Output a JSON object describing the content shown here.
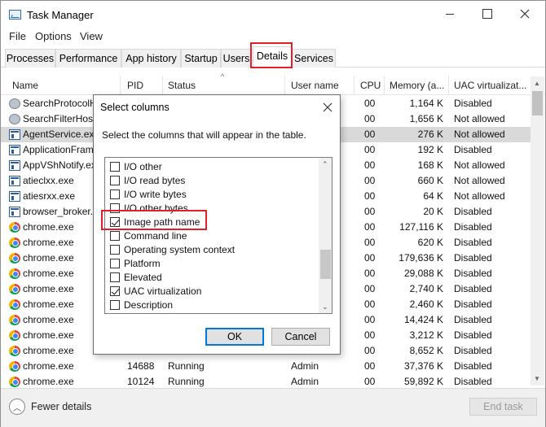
{
  "window": {
    "title": "Task Manager"
  },
  "menu": [
    "File",
    "Options",
    "View"
  ],
  "tabs": [
    "Processes",
    "Performance",
    "App history",
    "Startup",
    "Users",
    "Details",
    "Services"
  ],
  "active_tab": "Details",
  "columns": [
    "Name",
    "PID",
    "Status",
    "User name",
    "CPU",
    "Memory (a...",
    "UAC virtualizat..."
  ],
  "rows": [
    {
      "name": "SearchProtocolH",
      "pid": "",
      "status": "",
      "user": "",
      "cpu": "00",
      "mem": "1,164 K",
      "uac": "Disabled",
      "icon": "search"
    },
    {
      "name": "SearchFilterHost.",
      "pid": "",
      "status": "",
      "user": "",
      "cpu": "00",
      "mem": "1,656 K",
      "uac": "Not allowed",
      "icon": "search"
    },
    {
      "name": "AgentService.exe",
      "pid": "",
      "status": "",
      "user": "",
      "cpu": "00",
      "mem": "276 K",
      "uac": "Not allowed",
      "icon": "proc"
    },
    {
      "name": "ApplicationFram",
      "pid": "",
      "status": "",
      "user": "",
      "cpu": "00",
      "mem": "192 K",
      "uac": "Disabled",
      "icon": "proc"
    },
    {
      "name": "AppVShNotify.ex",
      "pid": "",
      "status": "",
      "user": "",
      "cpu": "00",
      "mem": "168 K",
      "uac": "Not allowed",
      "icon": "proc"
    },
    {
      "name": "atieclxx.exe",
      "pid": "",
      "status": "",
      "user": "",
      "cpu": "00",
      "mem": "660 K",
      "uac": "Not allowed",
      "icon": "proc"
    },
    {
      "name": "atiesrxx.exe",
      "pid": "",
      "status": "",
      "user": "",
      "cpu": "00",
      "mem": "64 K",
      "uac": "Not allowed",
      "icon": "proc"
    },
    {
      "name": "browser_broker.e",
      "pid": "",
      "status": "",
      "user": "",
      "cpu": "00",
      "mem": "20 K",
      "uac": "Disabled",
      "icon": "proc"
    },
    {
      "name": "chrome.exe",
      "pid": "",
      "status": "",
      "user": "",
      "cpu": "00",
      "mem": "127,116 K",
      "uac": "Disabled",
      "icon": "chrome"
    },
    {
      "name": "chrome.exe",
      "pid": "",
      "status": "",
      "user": "",
      "cpu": "00",
      "mem": "620 K",
      "uac": "Disabled",
      "icon": "chrome"
    },
    {
      "name": "chrome.exe",
      "pid": "",
      "status": "",
      "user": "",
      "cpu": "00",
      "mem": "179,636 K",
      "uac": "Disabled",
      "icon": "chrome"
    },
    {
      "name": "chrome.exe",
      "pid": "",
      "status": "",
      "user": "",
      "cpu": "00",
      "mem": "29,088 K",
      "uac": "Disabled",
      "icon": "chrome"
    },
    {
      "name": "chrome.exe",
      "pid": "",
      "status": "",
      "user": "",
      "cpu": "00",
      "mem": "2,740 K",
      "uac": "Disabled",
      "icon": "chrome"
    },
    {
      "name": "chrome.exe",
      "pid": "",
      "status": "",
      "user": "",
      "cpu": "00",
      "mem": "2,460 K",
      "uac": "Disabled",
      "icon": "chrome"
    },
    {
      "name": "chrome.exe",
      "pid": "",
      "status": "",
      "user": "",
      "cpu": "00",
      "mem": "14,424 K",
      "uac": "Disabled",
      "icon": "chrome"
    },
    {
      "name": "chrome.exe",
      "pid": "",
      "status": "",
      "user": "",
      "cpu": "00",
      "mem": "3,212 K",
      "uac": "Disabled",
      "icon": "chrome"
    },
    {
      "name": "chrome.exe",
      "pid": "",
      "status": "",
      "user": "",
      "cpu": "00",
      "mem": "8,652 K",
      "uac": "Disabled",
      "icon": "chrome"
    },
    {
      "name": "chrome.exe",
      "pid": "14688",
      "status": "Running",
      "user": "Admin",
      "cpu": "00",
      "mem": "37,376 K",
      "uac": "Disabled",
      "icon": "chrome"
    },
    {
      "name": "chrome.exe",
      "pid": "10124",
      "status": "Running",
      "user": "Admin",
      "cpu": "00",
      "mem": "59,892 K",
      "uac": "Disabled",
      "icon": "chrome"
    }
  ],
  "selected_row": 2,
  "footer": {
    "fewer_details": "Fewer details",
    "end_task": "End task"
  },
  "dialog": {
    "title": "Select columns",
    "description": "Select the columns that will appear in the table.",
    "options": [
      {
        "label": "I/O other",
        "checked": false
      },
      {
        "label": "I/O read bytes",
        "checked": false
      },
      {
        "label": "I/O write bytes",
        "checked": false
      },
      {
        "label": "I/O other bytes",
        "checked": false
      },
      {
        "label": "Image path name",
        "checked": true
      },
      {
        "label": "Command line",
        "checked": false
      },
      {
        "label": "Operating system context",
        "checked": false
      },
      {
        "label": "Platform",
        "checked": false
      },
      {
        "label": "Elevated",
        "checked": false
      },
      {
        "label": "UAC virtualization",
        "checked": true
      },
      {
        "label": "Description",
        "checked": false
      }
    ],
    "ok": "OK",
    "cancel": "Cancel"
  },
  "colors": {
    "highlight": "#e0202a",
    "selected_row": "#d9d9d9",
    "ok_border": "#0078d7"
  },
  "icons": {
    "close": "close-icon",
    "collapse": "chevron-up-icon",
    "app": "task-manager-icon"
  }
}
